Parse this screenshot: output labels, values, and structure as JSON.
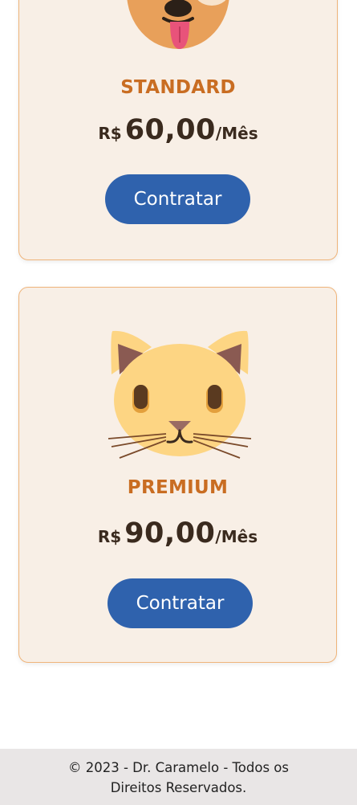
{
  "plans": [
    {
      "name": "STANDARD",
      "currency": "R$",
      "amount": "60,00",
      "period": "/Mês",
      "button_label": "Contratar",
      "icon": "dog-face-icon"
    },
    {
      "name": "PREMIUM",
      "currency": "R$",
      "amount": "90,00",
      "period": "/Mês",
      "button_label": "Contratar",
      "icon": "cat-face-icon"
    }
  ],
  "footer": {
    "line1": "© 2023 - Dr. Caramelo - Todos os",
    "line2": "Direitos Reservados."
  },
  "colors": {
    "card_background": "#f8efe6",
    "card_border": "#efb47a",
    "plan_name": "#c96d22",
    "button": "#2f62ad",
    "footer_background": "#e9e6e6"
  }
}
